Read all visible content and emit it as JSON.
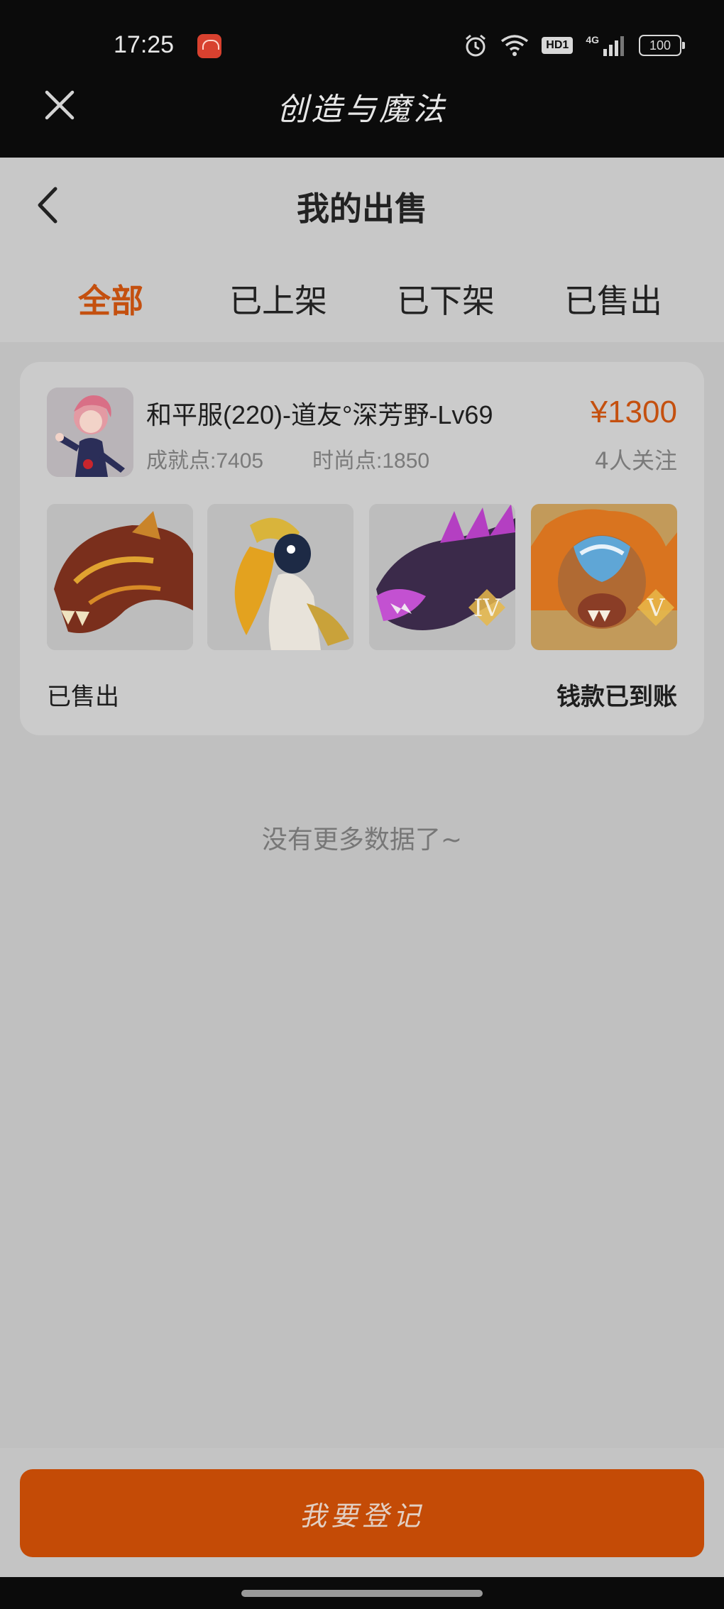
{
  "status_bar": {
    "time": "17:25",
    "network": "4G",
    "hd_label": "HD1",
    "battery": "100",
    "icons": [
      "alarm-icon",
      "wifi-icon",
      "hd-icon",
      "signal-icon",
      "battery-icon"
    ]
  },
  "mini_program": {
    "title": "创造与魔法",
    "close_icon": "close-icon"
  },
  "page": {
    "title": "我的出售",
    "back_icon": "chevron-left-icon"
  },
  "tabs": [
    {
      "label": "全部",
      "active": true
    },
    {
      "label": "已上架",
      "active": false
    },
    {
      "label": "已下架",
      "active": false
    },
    {
      "label": "已售出",
      "active": false
    }
  ],
  "listing": {
    "title": "和平服(220)-道友°深芳野-Lv69",
    "achievement": "成就点:7405",
    "fashion": "时尚点:1850",
    "price": "¥1300",
    "followers": "4人关注",
    "thumbnails": [
      {
        "name": "lava-dragon",
        "badge": ""
      },
      {
        "name": "hornbill",
        "badge": ""
      },
      {
        "name": "purple-beast",
        "badge": "IV"
      },
      {
        "name": "lion-mount",
        "badge": "V"
      }
    ],
    "status": "已售出",
    "payment_status": "钱款已到账"
  },
  "empty_message": "没有更多数据了~",
  "bottom": {
    "register_label": "我要登记"
  },
  "colors": {
    "accent": "#c4500f",
    "button": "#c44b06",
    "overlay_bg": "#c0c0c0",
    "header_bg": "#0b0b0b"
  }
}
